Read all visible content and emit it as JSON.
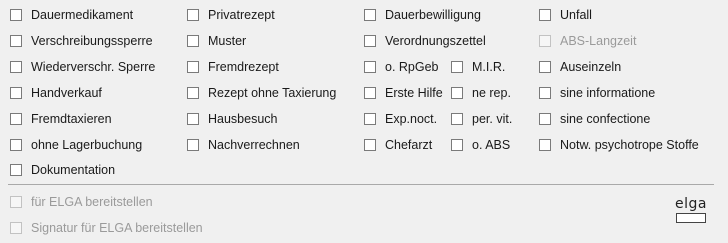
{
  "options": {
    "dauermedikament": "Dauermedikament",
    "verschreibungssperre": "Verschreibungssperre",
    "wiederverschr_sperre": "Wiederverschr. Sperre",
    "handverkauf": "Handverkauf",
    "fremdtaxieren": "Fremdtaxieren",
    "ohne_lagerbuchung": "ohne Lagerbuchung",
    "dokumentation": "Dokumentation",
    "privatrezept": "Privatrezept",
    "muster": "Muster",
    "fremdrezept": "Fremdrezept",
    "rezept_ohne_taxierung": "Rezept ohne Taxierung",
    "hausbesuch": "Hausbesuch",
    "nachverrechnen": "Nachverrechnen",
    "dauerbewilligung": "Dauerbewilligung",
    "verordnungszettel": "Verordnungszettel",
    "o_rpgeb": "o. RpGeb",
    "mir": "M.I.R.",
    "erste_hilfe": "Erste Hilfe",
    "ne_rep": "ne rep.",
    "exp_noct": "Exp.noct.",
    "per_vit": "per. vit.",
    "chefarzt": "Chefarzt",
    "o_abs": "o. ABS",
    "unfall": "Unfall",
    "abs_langzeit": "ABS-Langzeit",
    "auseinzeln": "Auseinzeln",
    "sine_informatione": "sine informatione",
    "sine_confectione": "sine confectione",
    "notw_psychotrope_stoffe": "Notw. psychotrope Stoffe"
  },
  "elga": {
    "bereitstellen": "für ELGA bereitstellen",
    "signatur": "Signatur für ELGA bereitstellen",
    "logo_text": "elga"
  },
  "checked": {
    "all": false
  },
  "colors": {
    "background": "#f0f0f0",
    "text": "#1a1a1a",
    "disabled_text": "#9a9a9a",
    "checkbox_border": "#7a7a7a"
  }
}
